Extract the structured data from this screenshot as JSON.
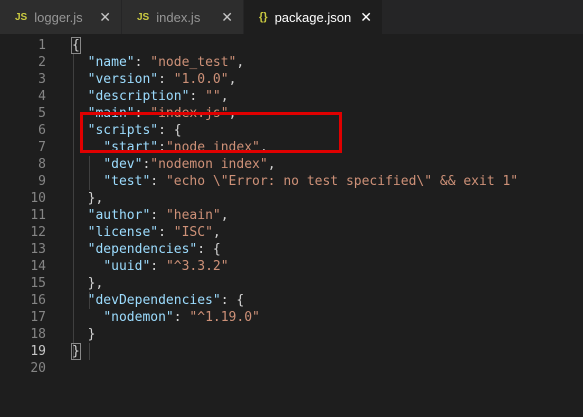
{
  "tabs": [
    {
      "label": "logger.js",
      "icon": "JS",
      "icon_name": "javascript-file-icon",
      "active": false
    },
    {
      "label": "index.js",
      "icon": "JS",
      "icon_name": "javascript-file-icon",
      "active": false
    },
    {
      "label": "package.json",
      "icon": "{}",
      "icon_name": "json-file-icon",
      "active": true
    }
  ],
  "close_glyph": "✕",
  "current_line": 19,
  "colors": {
    "key": "#9cdcfe",
    "string": "#ce9178",
    "punctuation": "#d4d4d4",
    "highlight_box": "#e00000"
  },
  "lines": [
    {
      "n": "1",
      "tokens": [
        {
          "t": "{",
          "c": "p"
        }
      ]
    },
    {
      "n": "2",
      "tokens": [
        {
          "t": "  ",
          "c": "p"
        },
        {
          "t": "\"name\"",
          "c": "k"
        },
        {
          "t": ": ",
          "c": "p"
        },
        {
          "t": "\"node_test\"",
          "c": "s"
        },
        {
          "t": ",",
          "c": "p"
        }
      ]
    },
    {
      "n": "3",
      "tokens": [
        {
          "t": "  ",
          "c": "p"
        },
        {
          "t": "\"version\"",
          "c": "k"
        },
        {
          "t": ": ",
          "c": "p"
        },
        {
          "t": "\"1.0.0\"",
          "c": "s"
        },
        {
          "t": ",",
          "c": "p"
        }
      ]
    },
    {
      "n": "4",
      "tokens": [
        {
          "t": "  ",
          "c": "p"
        },
        {
          "t": "\"description\"",
          "c": "k"
        },
        {
          "t": ": ",
          "c": "p"
        },
        {
          "t": "\"\"",
          "c": "s"
        },
        {
          "t": ",",
          "c": "p"
        }
      ]
    },
    {
      "n": "5",
      "tokens": [
        {
          "t": "  ",
          "c": "p"
        },
        {
          "t": "\"main\"",
          "c": "k"
        },
        {
          "t": ": ",
          "c": "p"
        },
        {
          "t": "\"index.js\"",
          "c": "s"
        },
        {
          "t": ",",
          "c": "p"
        }
      ]
    },
    {
      "n": "6",
      "tokens": [
        {
          "t": "  ",
          "c": "p"
        },
        {
          "t": "\"scripts\"",
          "c": "k"
        },
        {
          "t": ": {",
          "c": "p"
        }
      ]
    },
    {
      "n": "7",
      "tokens": [
        {
          "t": "    ",
          "c": "p"
        },
        {
          "t": "\"start\"",
          "c": "k"
        },
        {
          "t": ":",
          "c": "p"
        },
        {
          "t": "\"node index\"",
          "c": "s"
        },
        {
          "t": ",",
          "c": "p"
        }
      ]
    },
    {
      "n": "8",
      "tokens": [
        {
          "t": "    ",
          "c": "p"
        },
        {
          "t": "\"dev\"",
          "c": "k"
        },
        {
          "t": ":",
          "c": "p"
        },
        {
          "t": "\"nodemon index\"",
          "c": "s"
        },
        {
          "t": ",",
          "c": "p"
        }
      ]
    },
    {
      "n": "9",
      "tokens": [
        {
          "t": "    ",
          "c": "p"
        },
        {
          "t": "\"test\"",
          "c": "k"
        },
        {
          "t": ": ",
          "c": "p"
        },
        {
          "t": "\"echo \\\"Error: no test specified\\\" && exit 1\"",
          "c": "s"
        }
      ]
    },
    {
      "n": "10",
      "tokens": [
        {
          "t": "  },",
          "c": "p"
        }
      ]
    },
    {
      "n": "11",
      "tokens": [
        {
          "t": "  ",
          "c": "p"
        },
        {
          "t": "\"author\"",
          "c": "k"
        },
        {
          "t": ": ",
          "c": "p"
        },
        {
          "t": "\"heain\"",
          "c": "s"
        },
        {
          "t": ",",
          "c": "p"
        }
      ]
    },
    {
      "n": "12",
      "tokens": [
        {
          "t": "  ",
          "c": "p"
        },
        {
          "t": "\"license\"",
          "c": "k"
        },
        {
          "t": ": ",
          "c": "p"
        },
        {
          "t": "\"ISC\"",
          "c": "s"
        },
        {
          "t": ",",
          "c": "p"
        }
      ]
    },
    {
      "n": "13",
      "tokens": [
        {
          "t": "  ",
          "c": "p"
        },
        {
          "t": "\"dependencies\"",
          "c": "k"
        },
        {
          "t": ": {",
          "c": "p"
        }
      ]
    },
    {
      "n": "14",
      "tokens": [
        {
          "t": "    ",
          "c": "p"
        },
        {
          "t": "\"uuid\"",
          "c": "k"
        },
        {
          "t": ": ",
          "c": "p"
        },
        {
          "t": "\"^3.3.2\"",
          "c": "s"
        }
      ]
    },
    {
      "n": "15",
      "tokens": [
        {
          "t": "  },",
          "c": "p"
        }
      ]
    },
    {
      "n": "16",
      "tokens": [
        {
          "t": "  ",
          "c": "p"
        },
        {
          "t": "\"devDependencies\"",
          "c": "k"
        },
        {
          "t": ": {",
          "c": "p"
        }
      ]
    },
    {
      "n": "17",
      "tokens": [
        {
          "t": "    ",
          "c": "p"
        },
        {
          "t": "\"nodemon\"",
          "c": "k"
        },
        {
          "t": ": ",
          "c": "p"
        },
        {
          "t": "\"^1.19.0\"",
          "c": "s"
        }
      ]
    },
    {
      "n": "18",
      "tokens": [
        {
          "t": "  }",
          "c": "p"
        }
      ]
    },
    {
      "n": "19",
      "tokens": [
        {
          "t": "}",
          "c": "p"
        }
      ]
    },
    {
      "n": "20",
      "tokens": []
    }
  ]
}
